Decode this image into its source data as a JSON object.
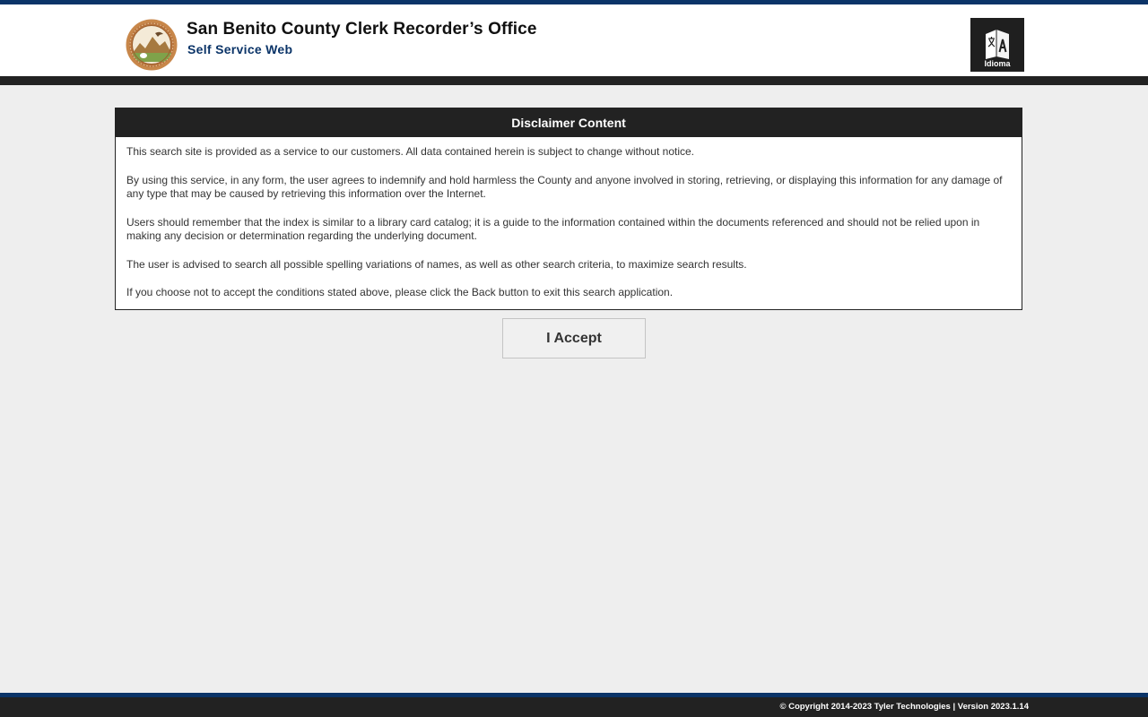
{
  "header": {
    "title": "San Benito County Clerk Recorder’s Office",
    "subtitle": "Self Service Web",
    "logo_icon": "county-seal-icon",
    "language_button": {
      "label": "Idioma",
      "icon": "translate-icon"
    }
  },
  "disclaimer": {
    "title": "Disclaimer Content",
    "paragraphs": [
      "This search site is provided as a service to our customers. All data contained herein is subject to change without notice.",
      "By using this service, in any form, the user agrees to indemnify and hold harmless the County and anyone involved in storing, retrieving, or displaying this information for any damage of any type that may be caused by retrieving this information over the Internet.",
      "Users should remember that the index is similar to a library card catalog; it is a guide to the information contained within the documents referenced and should not be relied upon in making any decision or determination regarding the underlying document.",
      "The user is advised to search all possible spelling variations of names, as well as other search criteria, to maximize search results.",
      "If you choose not to accept the conditions stated above, please click the Back button to exit this search application."
    ]
  },
  "accept_button": {
    "label": "I Accept"
  },
  "footer": {
    "text": "© Copyright 2014-2023 Tyler Technologies | Version 2023.1.14"
  },
  "colors": {
    "brand_blue": "#0b3468",
    "dark_bar": "#222222",
    "page_background": "#eeeeee"
  }
}
